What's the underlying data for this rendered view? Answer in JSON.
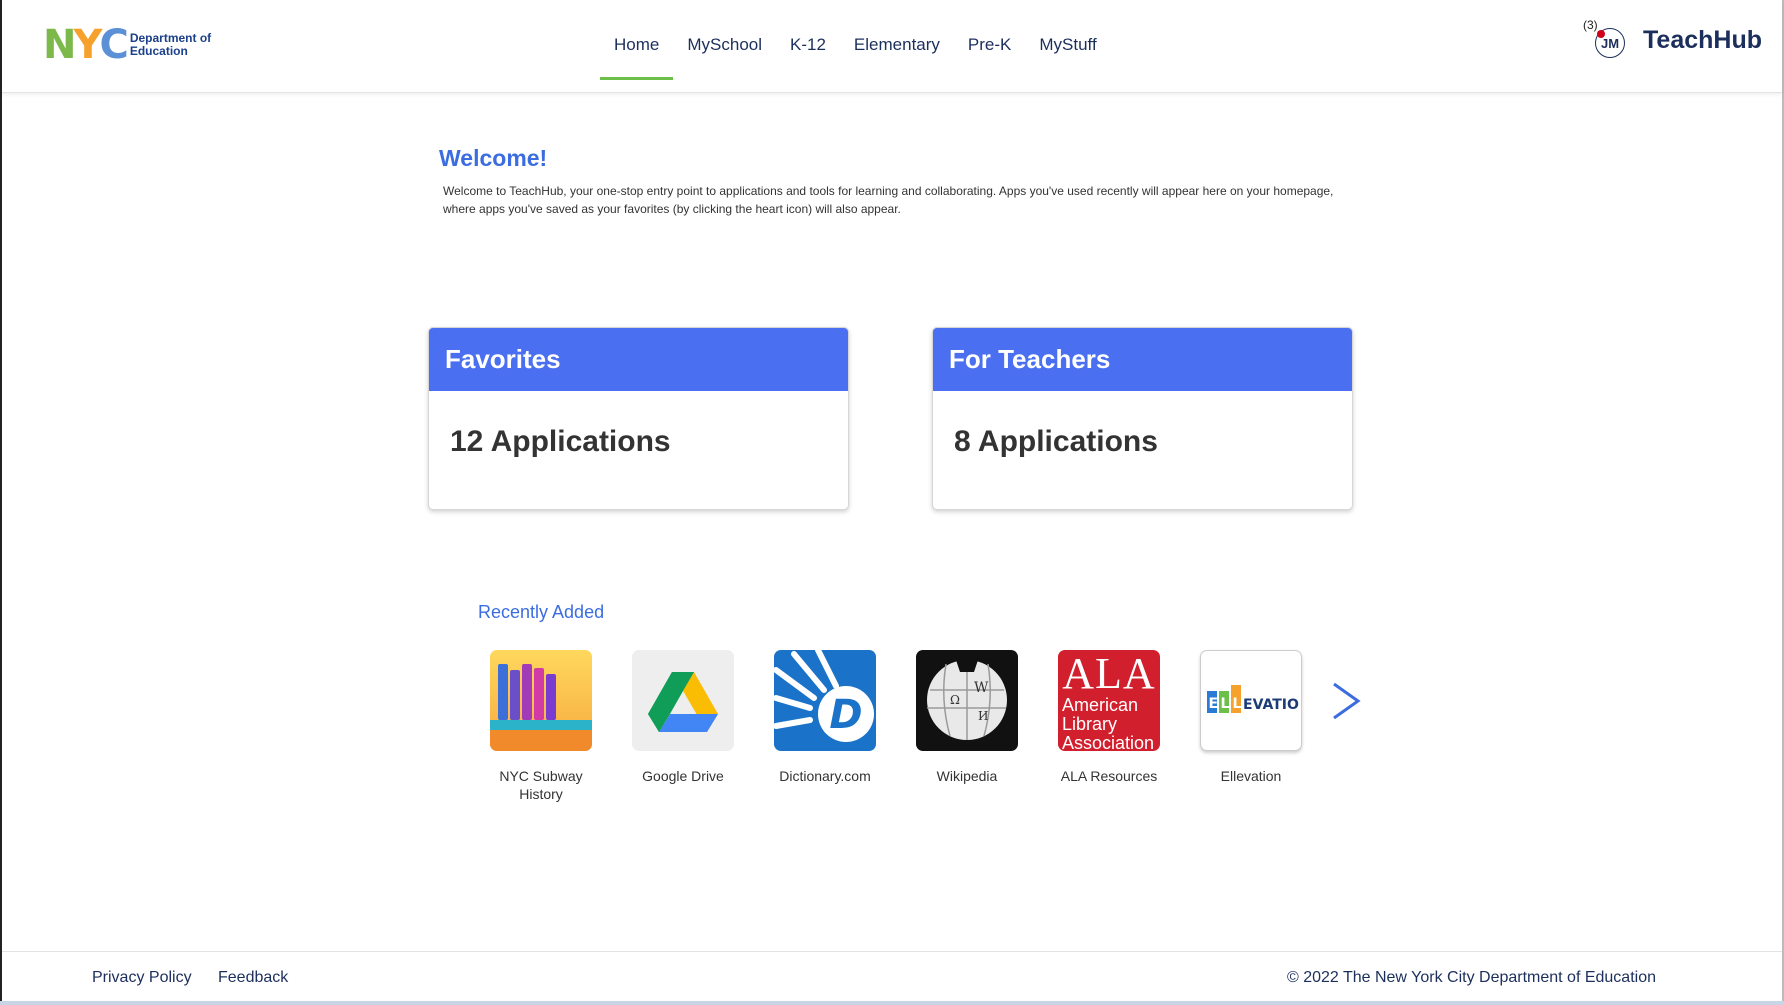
{
  "header": {
    "logo": {
      "letters": [
        "N",
        "Y",
        "C"
      ],
      "letter_colors": [
        "#7cb84a",
        "#f6a12b",
        "#5b8fd6"
      ],
      "line1": "Department of",
      "line2": "Education"
    },
    "nav": [
      {
        "label": "Home",
        "active": true
      },
      {
        "label": "MySchool",
        "active": false
      },
      {
        "label": "K-12",
        "active": false
      },
      {
        "label": "Elementary",
        "active": false
      },
      {
        "label": "Pre-K",
        "active": false
      },
      {
        "label": "MyStuff",
        "active": false
      }
    ],
    "notification_count": "(3)",
    "avatar_initials": "JM",
    "brand": "TeachHub"
  },
  "welcome": {
    "title": "Welcome!",
    "text": "Welcome to TeachHub, your one-stop entry point to applications and tools for learning and collaborating. Apps you've used recently will appear here on your homepage, where apps you've saved as your favorites (by clicking the heart icon) will also appear."
  },
  "cards": {
    "favorites": {
      "title": "Favorites",
      "count": "12 Applications"
    },
    "teachers": {
      "title": "For Teachers",
      "count": "8 Applications"
    }
  },
  "recent": {
    "title": "Recently Added",
    "apps": [
      {
        "label": "NYC Subway History",
        "icon": "library-books-icon"
      },
      {
        "label": "Google Drive",
        "icon": "google-drive-icon"
      },
      {
        "label": "Dictionary.com",
        "icon": "dictionary-icon"
      },
      {
        "label": "Wikipedia",
        "icon": "wikipedia-globe-icon"
      },
      {
        "label": "ALA Resources",
        "icon": "ala-icon",
        "tile_text": [
          "ALA",
          "American",
          "Library",
          "Association"
        ]
      },
      {
        "label": "Ellevation",
        "icon": "ellevation-icon",
        "tile_text": "ELLEVATION"
      }
    ],
    "next_icon": "chevron-right-icon"
  },
  "footer": {
    "privacy": "Privacy Policy",
    "feedback": "Feedback",
    "copyright": "© 2022 The New York City Department of Education"
  },
  "colors": {
    "accent_blue": "#4a6ff0",
    "link_blue": "#3b6de0",
    "nav_text": "#1c2f5c",
    "active_underline": "#6cc04a"
  }
}
